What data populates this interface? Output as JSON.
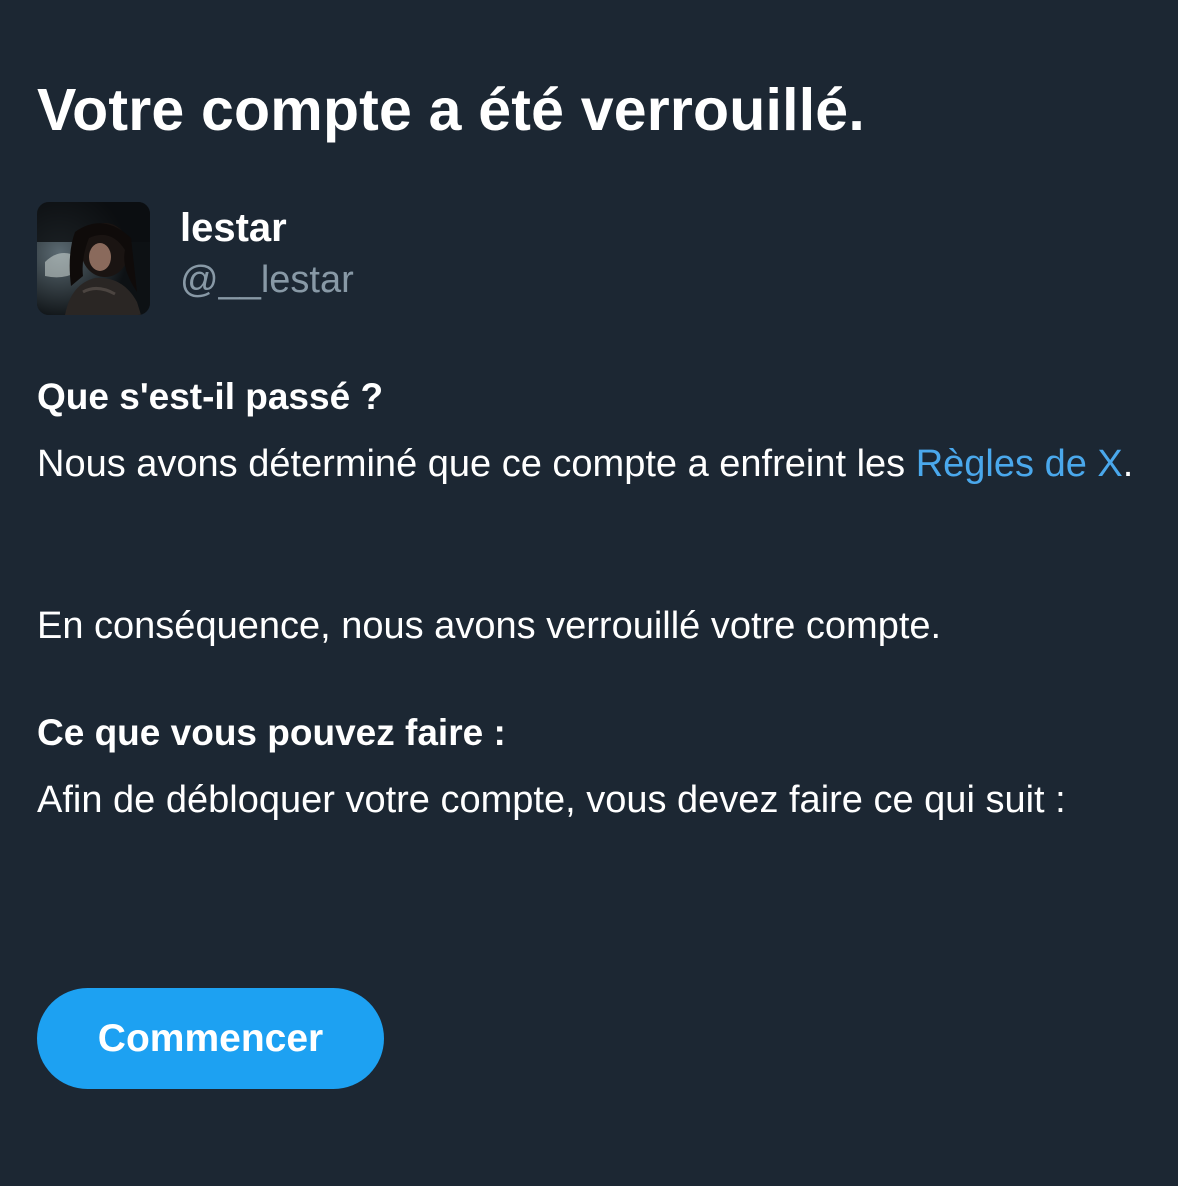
{
  "header": {
    "title": "Votre compte a été verrouillé."
  },
  "profile": {
    "display_name": "lestar",
    "handle": "@__lestar"
  },
  "what_happened": {
    "heading": "Que s'est-il passé ?",
    "text_before_link": "Nous avons déterminé que ce compte a enfreint les ",
    "link_label": "Règles de X",
    "text_after_link": ".",
    "consequence": "En conséquence, nous avons verrouillé votre compte."
  },
  "what_you_can_do": {
    "heading": "Ce que vous pouvez faire :",
    "text": "Afin de débloquer votre compte, vous devez faire ce qui suit :"
  },
  "actions": {
    "start_label": "Commencer"
  },
  "colors": {
    "background": "#1c2733",
    "accent": "#1da1f2",
    "link": "#4aa8ec",
    "secondary_text": "#8899a6"
  },
  "icons": {
    "avatar": "profile-photo"
  }
}
